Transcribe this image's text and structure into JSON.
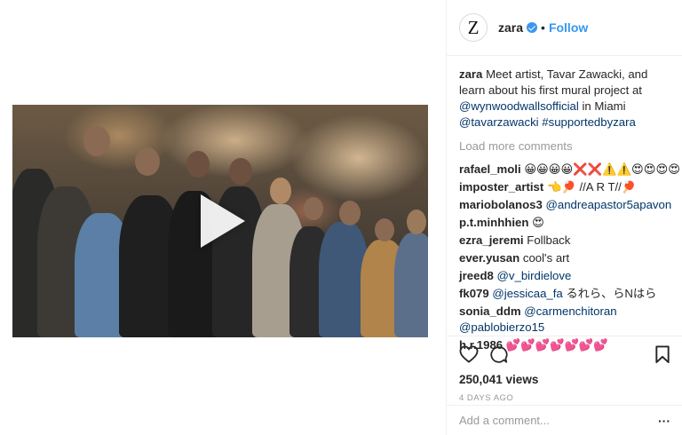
{
  "post": {
    "username": "zara",
    "avatar_letter": "Z",
    "follow_separator": "•",
    "follow_label": "Follow"
  },
  "caption": {
    "user": "zara",
    "text_1": "Meet artist, Tavar Zawacki, and learn about his first mural project at",
    "mention_1": "@wynwoodwallsofficial",
    "text_2": "in Miami",
    "mention_2": "@tavarzawacki",
    "hashtag": "#supportedbyzara"
  },
  "load_more": "Load more comments",
  "comments": [
    {
      "user": "rafael_moli",
      "pre": "",
      "mention": "",
      "text": "😀😀😀😀❌❌⚠️⚠️😍😍😍😍"
    },
    {
      "user": "imposter_artist",
      "pre": "",
      "mention": "",
      "text": "👈🏓 //A R T//🏓"
    },
    {
      "user": "mariobolanos3",
      "pre": "",
      "mention": "@andreapastor5apavon",
      "text": ""
    },
    {
      "user": "p.t.minhhien",
      "pre": "",
      "mention": "",
      "text": "😍"
    },
    {
      "user": "ezra_jeremi",
      "pre": "",
      "mention": "",
      "text": "Follback"
    },
    {
      "user": "ever.yusan",
      "pre": "",
      "mention": "",
      "text": "cool's art"
    },
    {
      "user": "jreed8",
      "pre": "",
      "mention": "@v_birdielove",
      "text": ""
    },
    {
      "user": "fk079",
      "pre": "",
      "mention": "@jessicaa_fa",
      "text": "るれら、らNはら"
    },
    {
      "user": "sonia_ddm",
      "pre": "",
      "mention": "@carmenchitoran",
      "text": "",
      "mention2": "@pablobierzo15"
    },
    {
      "user": "h.r.1986",
      "pre": "",
      "mention": "",
      "text": "💕💕💕💕💕💕💕"
    }
  ],
  "stats": {
    "views": "250,041 views",
    "time": "4 DAYS AGO"
  },
  "add_comment": {
    "placeholder": "Add a comment...",
    "more": "···"
  },
  "icons": {
    "like": "heart-icon",
    "comment": "comment-icon",
    "save": "bookmark-icon",
    "verified": "verified-badge-icon",
    "play": "play-icon"
  },
  "colors": {
    "link": "#003569",
    "follow": "#3897f0",
    "muted": "#999999"
  }
}
